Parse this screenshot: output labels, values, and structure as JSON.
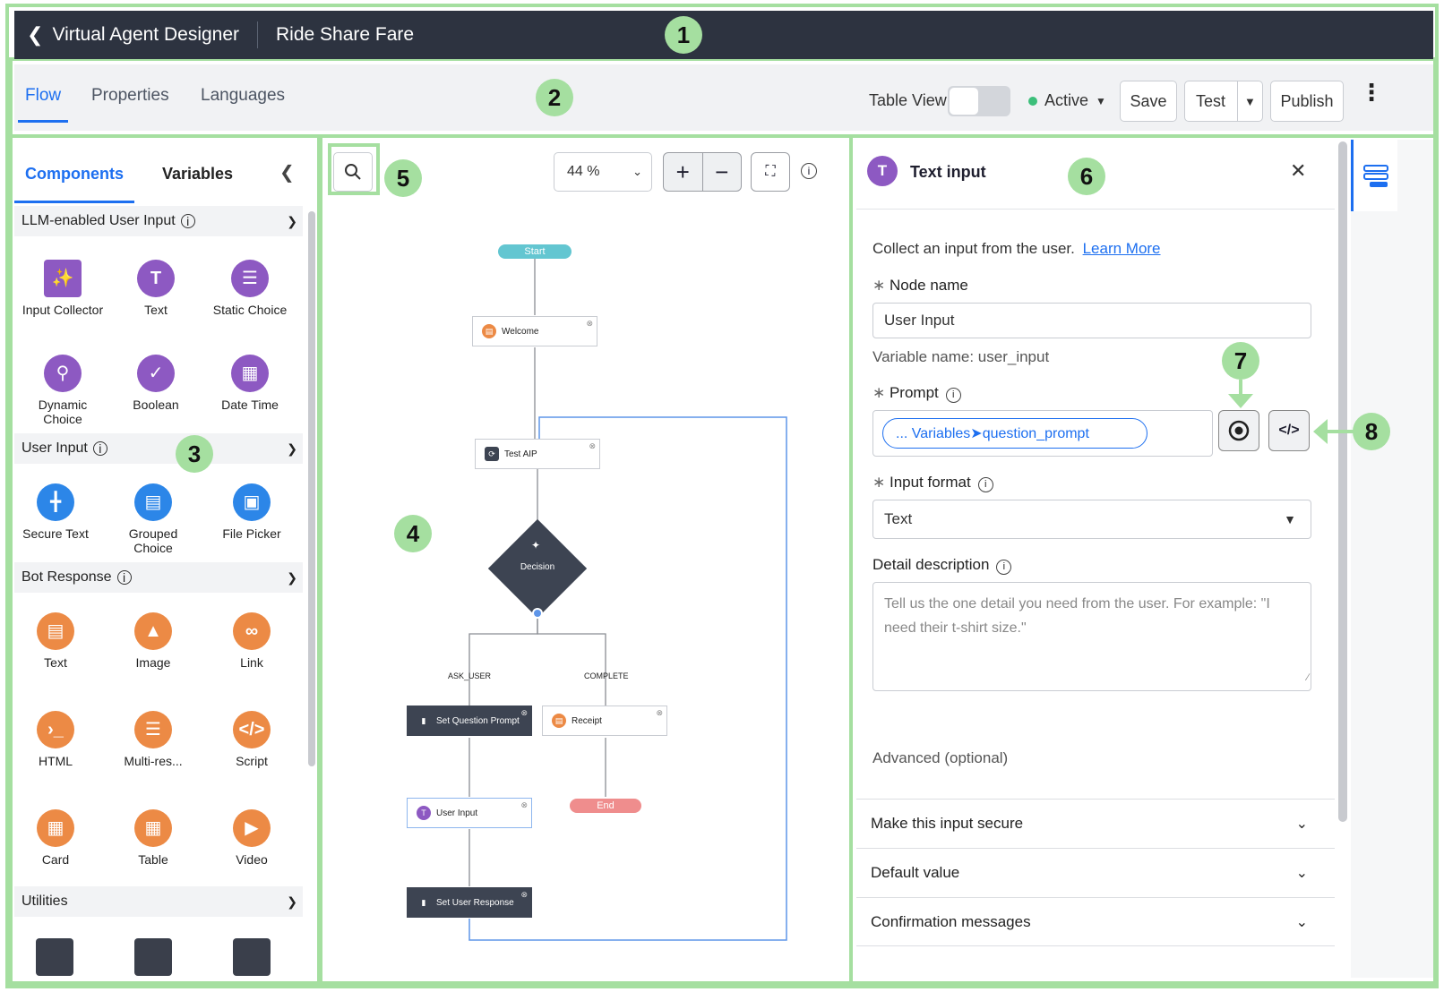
{
  "header": {
    "back_label": "Virtual Agent Designer",
    "title": "Ride Share Fare"
  },
  "toolbar": {
    "tabs": [
      "Flow",
      "Properties",
      "Languages"
    ],
    "table_view_label": "Table View",
    "status_label": "Active",
    "save_label": "Save",
    "test_label": "Test",
    "publish_label": "Publish"
  },
  "left_panel": {
    "tabs": [
      "Components",
      "Variables"
    ],
    "sections": [
      {
        "title": "LLM-enabled User Input",
        "items": [
          "Input Collector",
          "Text",
          "Static Choice",
          "Dynamic Choice",
          "Boolean",
          "Date Time"
        ]
      },
      {
        "title": "User Input",
        "items": [
          "Secure Text",
          "Grouped Choice",
          "File Picker"
        ]
      },
      {
        "title": "Bot Response",
        "items": [
          "Text",
          "Image",
          "Link",
          "HTML",
          "Multi-res...",
          "Script",
          "Card",
          "Table",
          "Video"
        ]
      },
      {
        "title": "Utilities",
        "items": []
      }
    ]
  },
  "canvas": {
    "zoom": "44 %",
    "nodes": {
      "start": "Start",
      "welcome": "Welcome",
      "test_aip": "Test AIP",
      "decision": "Decision",
      "ask_user": "ASK_USER",
      "complete": "COMPLETE",
      "set_question_prompt": "Set Question Prompt",
      "receipt": "Receipt",
      "user_input": "User Input",
      "end": "End",
      "set_user_response": "Set User Response"
    }
  },
  "properties": {
    "title": "Text input",
    "description": "Collect an input from the user.",
    "learn_more": "Learn More",
    "node_name_label": "Node name",
    "node_name_value": "User Input",
    "variable_name": "Variable name: user_input",
    "prompt_label": "Prompt",
    "prompt_value": "... Variables➤question_prompt",
    "input_format_label": "Input format",
    "input_format_value": "Text",
    "detail_label": "Detail description",
    "detail_placeholder": "Tell us the one detail you need from the user. For example: \"I need their t-shirt size.\"",
    "advanced_label": "Advanced (optional)",
    "accordions": [
      "Make this input secure",
      "Default value",
      "Confirmation messages"
    ]
  },
  "callouts": [
    "1",
    "2",
    "3",
    "4",
    "5",
    "6",
    "7",
    "8"
  ],
  "colors": {
    "accent": "#1d6ff0",
    "annotation": "#a5dfa0",
    "topbar": "#2d3340",
    "active_dot": "#3cbf7a"
  }
}
